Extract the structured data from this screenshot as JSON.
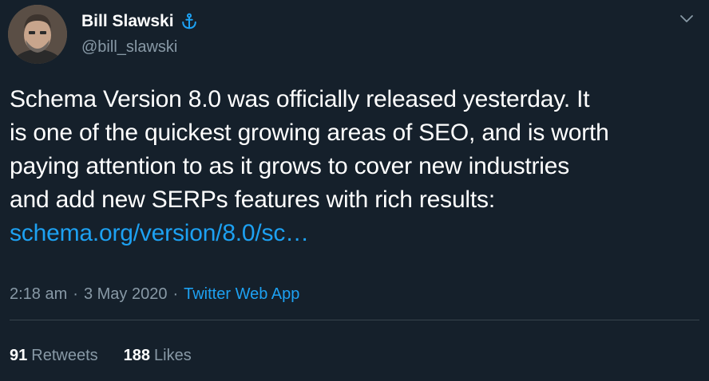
{
  "user": {
    "display_name": "Bill Slawski",
    "handle": "@bill_slawski"
  },
  "tweet": {
    "text_lines": [
      "Schema Version 8.0 was officially released yesterday.  It",
      "is one of the quickest growing areas of SEO, and is worth",
      "paying attention to as it grows to cover new industries",
      "and add new SERPs features with rich results:"
    ],
    "link_text": "schema.org/version/8.0/sc…"
  },
  "meta": {
    "time": "2:18 am",
    "separator": "·",
    "date": "3 May 2020",
    "source": "Twitter Web App"
  },
  "stats": {
    "retweets_count": "91",
    "retweets_label": "Retweets",
    "likes_count": "188",
    "likes_label": "Likes"
  },
  "colors": {
    "background": "#15202b",
    "text": "#ffffff",
    "secondary_text": "#8899a6",
    "link": "#1da1f2",
    "divider": "#38444d"
  },
  "icons": {
    "badge": "anchor-icon",
    "menu": "chevron-down-icon"
  }
}
